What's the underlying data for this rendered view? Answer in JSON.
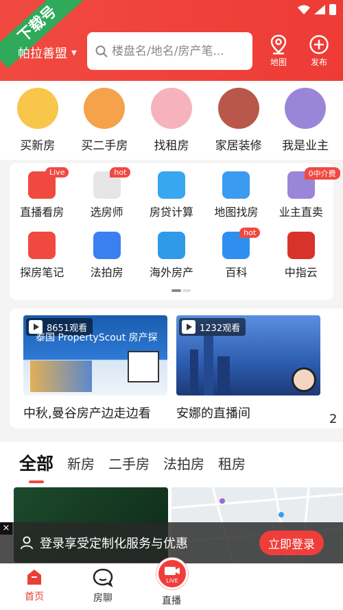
{
  "header": {
    "corner_label": "下载号",
    "city": "帕拉善盟",
    "search_placeholder": "楼盘名/地名/房产笔...",
    "map_label": "地图",
    "publish_label": "发布"
  },
  "categories": [
    {
      "label": "买新房",
      "icon": "dragon-icon",
      "color": "#f7c64a"
    },
    {
      "label": "买二手房",
      "icon": "tiger-icon",
      "color": "#f5a24a"
    },
    {
      "label": "找租房",
      "icon": "pig-icon",
      "color": "#f7b3bd"
    },
    {
      "label": "家居装修",
      "icon": "ox-icon",
      "color": "#b9584a"
    },
    {
      "label": "我是业主",
      "icon": "rat-icon",
      "color": "#9a86d8"
    }
  ],
  "services": [
    {
      "label": "直播看房",
      "icon": "live-video-icon",
      "badge": "Live",
      "color": "#f04a40"
    },
    {
      "label": "选房师",
      "icon": "advisor-avatar-icon",
      "badge": "hot",
      "color": "#e6e6e6"
    },
    {
      "label": "房贷计算",
      "icon": "calculator-icon",
      "badge": "",
      "color": "#36a7f0"
    },
    {
      "label": "地图找房",
      "icon": "map-pin-icon",
      "badge": "",
      "color": "#3b9bf0"
    },
    {
      "label": "业主直卖",
      "icon": "owner-mascot-icon",
      "badge": "0中介费",
      "color": "#9a86d8"
    },
    {
      "label": "探房笔记",
      "icon": "play-note-icon",
      "badge": "",
      "color": "#f04a40"
    },
    {
      "label": "法拍房",
      "icon": "gavel-icon",
      "badge": "",
      "color": "#3b80f0"
    },
    {
      "label": "海外房产",
      "icon": "airplane-icon",
      "badge": "",
      "color": "#2f9be8"
    },
    {
      "label": "百科",
      "icon": "book-icon",
      "badge": "hot",
      "color": "#2f8ff0"
    },
    {
      "label": "中指云",
      "icon": "cloud-logo-icon",
      "badge": "",
      "color": "#d8332b"
    }
  ],
  "live_cards": [
    {
      "views": "8651观看",
      "title": "中秋,曼谷房产边走边看",
      "thumb_text": "泰国 PropertyScout 房产探",
      "thumb_color": "#1a5cae"
    },
    {
      "views": "1232观看",
      "title": "安娜的直播间",
      "thumb_text": "",
      "thumb_color": "#3f7ad0"
    }
  ],
  "live_card_overflow": "2",
  "tabs": [
    {
      "label": "全部",
      "active": true
    },
    {
      "label": "新房",
      "active": false
    },
    {
      "label": "二手房",
      "active": false
    },
    {
      "label": "法拍房",
      "active": false
    },
    {
      "label": "租房",
      "active": false
    }
  ],
  "login_banner": {
    "text": "登录享受定制化服务与优惠",
    "button": "立即登录",
    "close": "×"
  },
  "bottom_nav": {
    "home": "首页",
    "chat": "房聊",
    "live": "直播",
    "live_badge": "LIVE"
  },
  "colors": {
    "brand_red": "#ef3e3a",
    "corner_green": "#2faa5a"
  }
}
